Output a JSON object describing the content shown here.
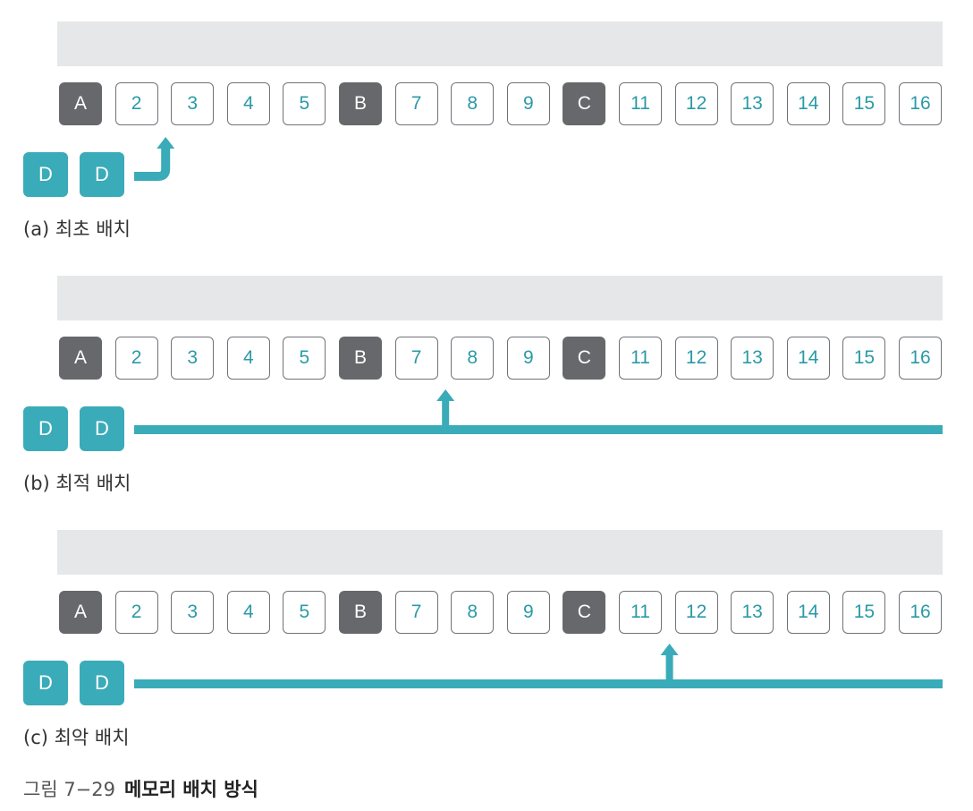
{
  "cells": [
    {
      "label": "A",
      "state": "used"
    },
    {
      "label": "2",
      "state": "free"
    },
    {
      "label": "3",
      "state": "free"
    },
    {
      "label": "4",
      "state": "free"
    },
    {
      "label": "5",
      "state": "free"
    },
    {
      "label": "B",
      "state": "used"
    },
    {
      "label": "7",
      "state": "free"
    },
    {
      "label": "8",
      "state": "free"
    },
    {
      "label": "9",
      "state": "free"
    },
    {
      "label": "C",
      "state": "used"
    },
    {
      "label": "11",
      "state": "free"
    },
    {
      "label": "12",
      "state": "free"
    },
    {
      "label": "13",
      "state": "free"
    },
    {
      "label": "14",
      "state": "free"
    },
    {
      "label": "15",
      "state": "free"
    },
    {
      "label": "16",
      "state": "free"
    }
  ],
  "process_blocks": [
    "D",
    "D"
  ],
  "panels": [
    {
      "id": "a",
      "caption": "(a) 최초 배치",
      "arrow_style": "hook",
      "target_label": "3"
    },
    {
      "id": "b",
      "caption": "(b) 최적 배치",
      "arrow_style": "line",
      "target_label": "8"
    },
    {
      "id": "c",
      "caption": "(c) 최악 배치",
      "arrow_style": "line",
      "target_label": "12"
    }
  ],
  "figure": {
    "number": "그림 7−29",
    "title": "메모리 배치 방식"
  },
  "colors": {
    "used": "#67686c",
    "free_border": "#6f7378",
    "free_text": "#2b9aa7",
    "process": "#3aabb8",
    "bar": "#e6e7e9"
  }
}
